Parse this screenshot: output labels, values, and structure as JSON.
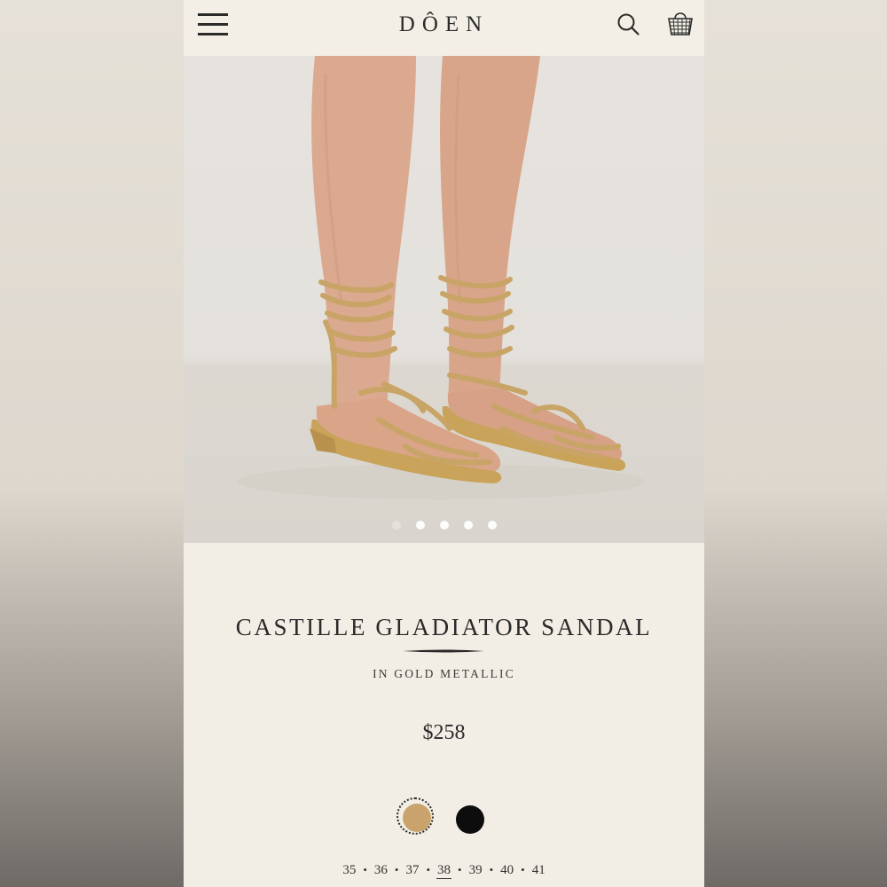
{
  "header": {
    "brand": "DÔEN",
    "menu_icon": "hamburger-menu-icon",
    "search_icon": "search-icon",
    "cart_icon": "basket-icon"
  },
  "gallery": {
    "slide_count": 5,
    "active_slide": 1
  },
  "product": {
    "name": "CASTILLE GLADIATOR SANDAL",
    "color_label": "IN GOLD METALLIC",
    "price": "$258"
  },
  "colors": [
    {
      "name": "gold",
      "hex": "#c9a36b",
      "selected": true
    },
    {
      "name": "black",
      "hex": "#0d0d0d",
      "selected": false
    }
  ],
  "sizes": [
    "35",
    "36",
    "37",
    "38",
    "39",
    "40",
    "41"
  ],
  "selected_size": "38",
  "theme": {
    "background": "#f2eee5",
    "text": "#2a2a2a"
  }
}
